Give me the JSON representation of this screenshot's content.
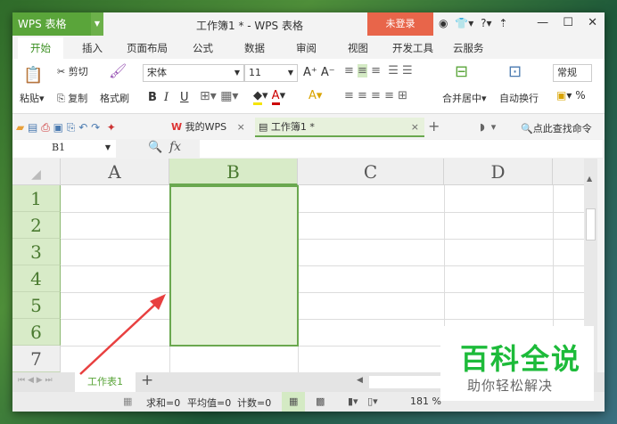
{
  "app": {
    "brand": "WPS 表格",
    "title": "工作簿1 * - WPS 表格",
    "login": "未登录",
    "accent": "#5aa53a",
    "login_color": "#e8654a"
  },
  "tabs": [
    "开始",
    "插入",
    "页面布局",
    "公式",
    "数据",
    "审阅",
    "视图",
    "开发工具",
    "云服务"
  ],
  "ribbon": {
    "paste": "粘贴",
    "cut": "剪切",
    "copy": "复制",
    "format_painter": "格式刷",
    "font": "宋体",
    "size": "11",
    "bold": "B",
    "italic": "I",
    "underline": "U",
    "merge": "合并居中",
    "wrap": "自动换行",
    "number_format": "常规",
    "percent": "%"
  },
  "doc_tabs": {
    "mywps": "我的WPS",
    "book": "工作簿1 *",
    "search": "点此查找命令"
  },
  "formula": {
    "name_box": "B1",
    "fx": "fx",
    "value": ""
  },
  "columns": [
    "A",
    "B",
    "C",
    "D"
  ],
  "rows": [
    "1",
    "2",
    "3",
    "4",
    "5",
    "6",
    "7"
  ],
  "sheets": {
    "tab": "工作表1",
    "add": "+"
  },
  "status": {
    "sum": "求和=0",
    "avg": "平均值=0",
    "count": "计数=0",
    "zoom": "181 %"
  },
  "watermark": {
    "title": "百科全说",
    "subtitle": "助你轻松解决"
  }
}
